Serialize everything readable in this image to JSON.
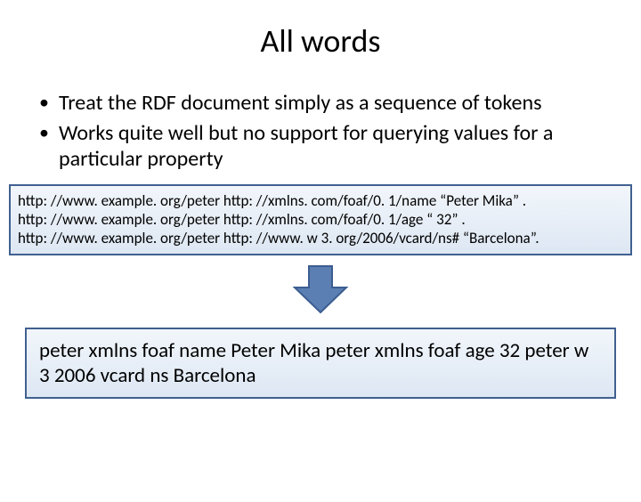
{
  "title": "All words",
  "bullets": [
    "Treat the RDF document simply as a sequence of tokens",
    "Works quite well but no support for querying values for a particular property"
  ],
  "rdf_lines": [
    "http: //www. example. org/peter http: //xmlns. com/foaf/0. 1/name “Peter Mika” .",
    "http: //www. example. org/peter http: //xmlns. com/foaf/0. 1/age “ 32” .",
    "http: //www. example. org/peter http: //www. w 3. org/2006/vcard/ns# “Barcelona”."
  ],
  "tokens_text": "peter xmlns foaf name Peter Mika peter xmlns foaf age 32 peter w 3 2006 vcard ns Barcelona",
  "arrow_icon": "down-arrow-icon",
  "colors": {
    "box_border": "#406090",
    "arrow_fill": "#5b7fb2"
  }
}
